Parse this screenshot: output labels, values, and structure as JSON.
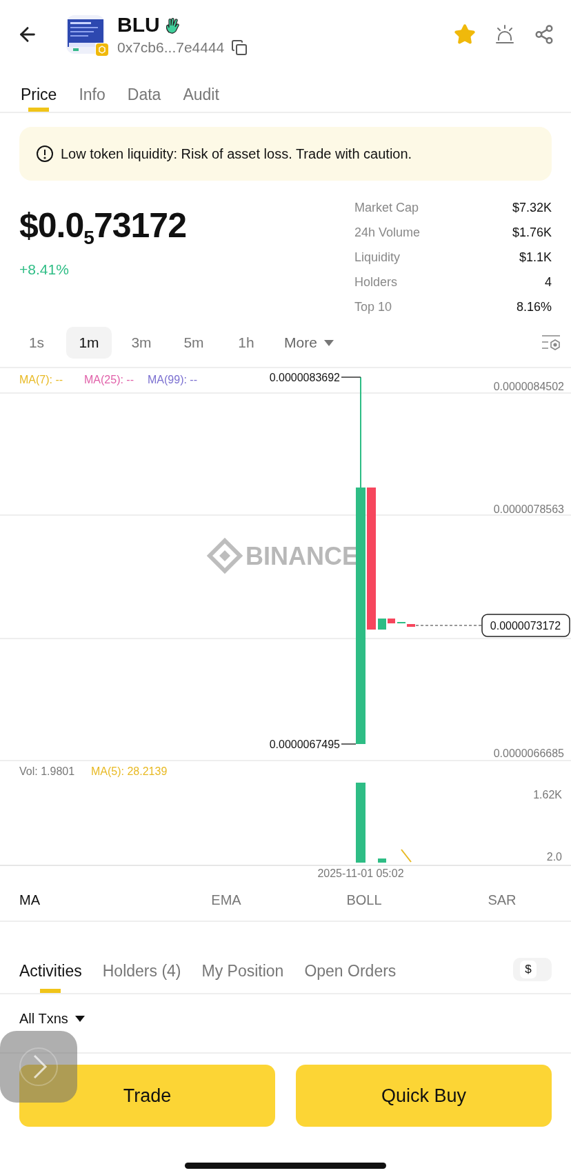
{
  "header": {
    "title": "BLU",
    "address": "0x7cb6...7e4444"
  },
  "tabs": [
    {
      "label": "Price",
      "selected": true
    },
    {
      "label": "Info",
      "selected": false
    },
    {
      "label": "Data",
      "selected": false
    },
    {
      "label": "Audit",
      "selected": false
    }
  ],
  "warning": "Low token liquidity: Risk of asset loss. Trade with caution.",
  "price": "$0.0$_{5}$73172",
  "change": "+8.41%",
  "stats": [
    {
      "label": "Market Cap",
      "value": "$7.32K"
    },
    {
      "label": "24h Volume",
      "value": "$1.76K"
    },
    {
      "label": "Liquidity",
      "value": "$1.1K"
    },
    {
      "label": "Holders",
      "value": "4"
    },
    {
      "label": "Top 10",
      "value": "8.16%"
    }
  ],
  "intervals": [
    {
      "label": "1s",
      "selected": false
    },
    {
      "label": "1m",
      "selected": true
    },
    {
      "label": "3m",
      "selected": false
    },
    {
      "label": "5m",
      "selected": false
    },
    {
      "label": "1h",
      "selected": false
    }
  ],
  "more": "More",
  "chart": {
    "indicators": [
      {
        "label": "MA(7): --",
        "color": "#e8b923"
      },
      {
        "label": "MA(25): --",
        "color": "#e05fa8"
      },
      {
        "label": "MA(99): --",
        "color": "#7a6fd0"
      }
    ],
    "price_axis": [
      "0.0000084502",
      "0.0000078563",
      "0.0000066685"
    ],
    "high": "0.0000083692",
    "low": "0.0000067495",
    "last": "0.0000073172",
    "watermark": "BINANCE",
    "volume": {
      "reading": "Vol: 1.9801",
      "ma": "MA(5): 28.2139",
      "axis": [
        "1.62K",
        "2.0"
      ]
    },
    "time": "2025-11-01 05:02"
  },
  "indicator_tabs": [
    {
      "label": "MA",
      "selected": true
    },
    {
      "label": "EMA",
      "selected": false
    },
    {
      "label": "BOLL",
      "selected": false
    },
    {
      "label": "SAR",
      "selected": false
    }
  ],
  "activity_tabs": [
    {
      "label": "Activities",
      "selected": true
    },
    {
      "label": "Holders (4)",
      "selected": false
    },
    {
      "label": "My Position",
      "selected": false
    },
    {
      "label": "Open Orders",
      "selected": false
    }
  ],
  "currency_toggle": "$",
  "filter": "All Txns",
  "buttons": [
    "Trade",
    "Quick Buy"
  ]
}
